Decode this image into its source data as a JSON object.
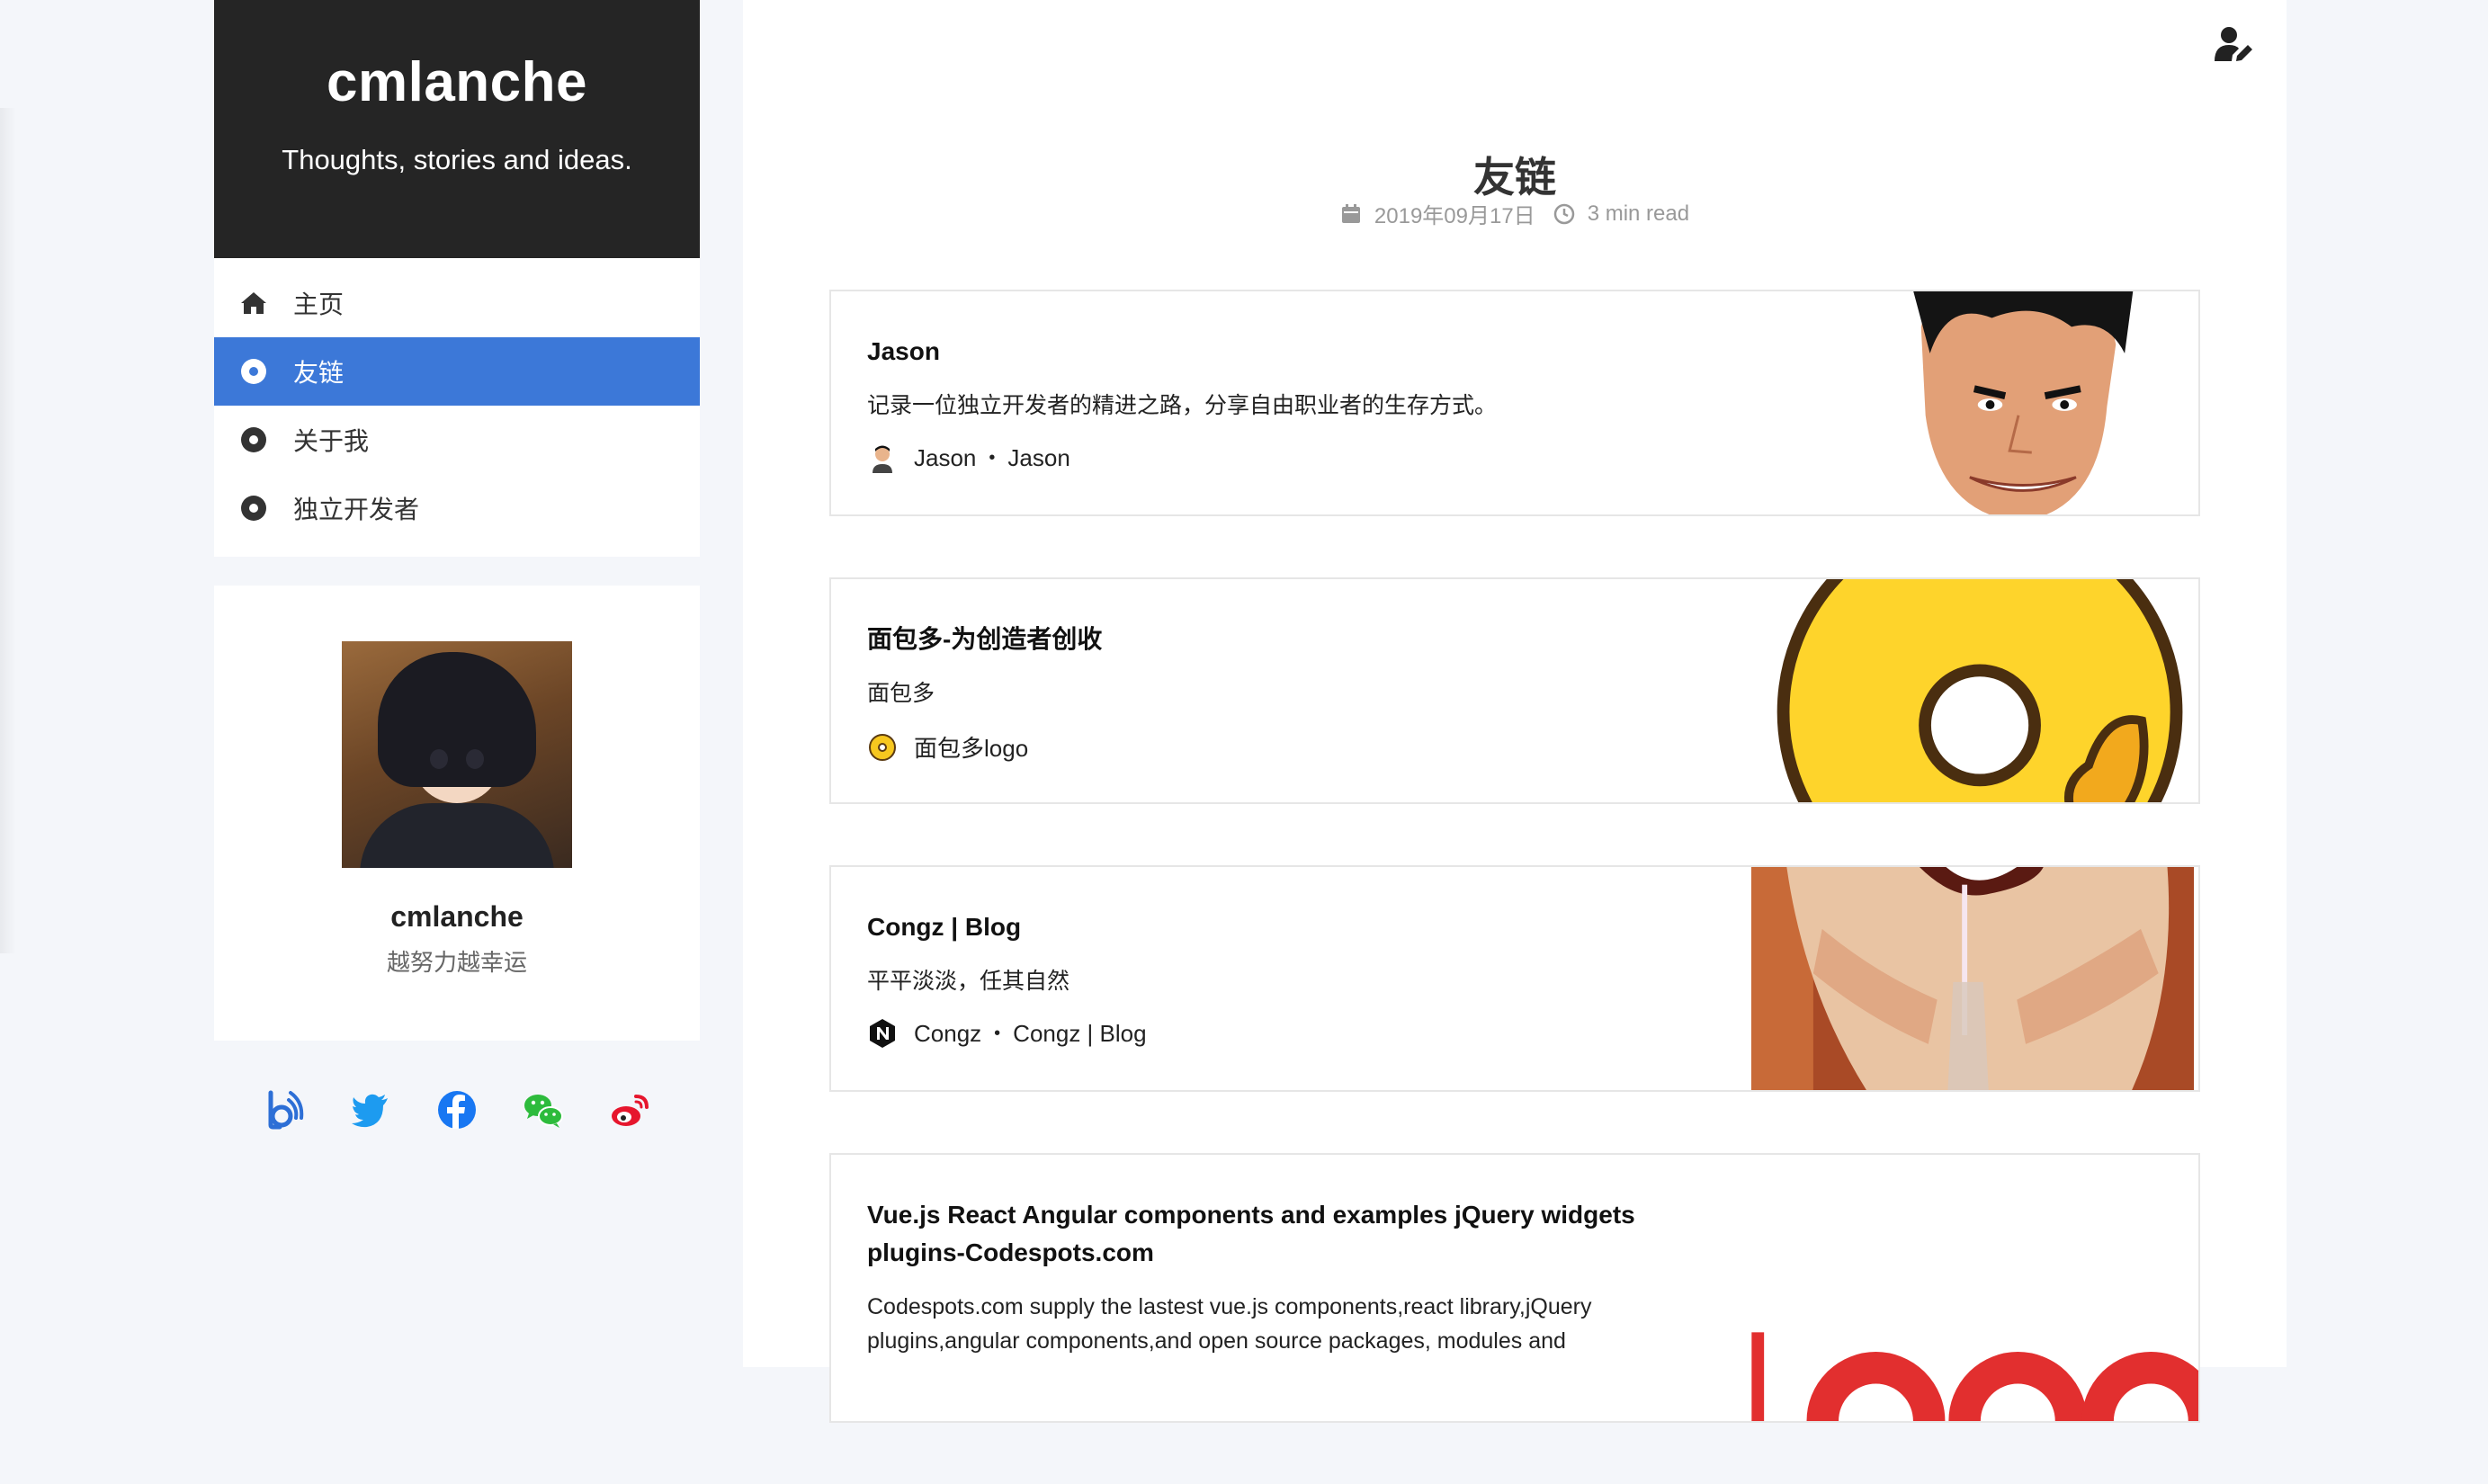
{
  "site": {
    "title": "cmlanche",
    "subtitle": "Thoughts, stories and ideas."
  },
  "nav": {
    "items": [
      {
        "label": "主页",
        "icon": "home-icon"
      },
      {
        "label": "友链",
        "icon": "dot-circle-icon",
        "active": true
      },
      {
        "label": "关于我",
        "icon": "dot-circle-icon"
      },
      {
        "label": "独立开发者",
        "icon": "dot-circle-icon"
      }
    ]
  },
  "profile": {
    "name": "cmlanche",
    "motto": "越努力越幸运"
  },
  "social": [
    "bilibili-icon",
    "twitter-icon",
    "facebook-icon",
    "wechat-icon",
    "weibo-icon"
  ],
  "page": {
    "title": "友链",
    "date": "2019年09月17日",
    "read_time": "3 min read"
  },
  "cards": [
    {
      "title": "Jason",
      "desc": "记录一位独立开发者的精进之路，分享自由职业者的生存方式。",
      "author": "Jason",
      "site": "Jason"
    },
    {
      "title": "面包多-为创造者创收",
      "desc": "面包多",
      "author": "面包多logo"
    },
    {
      "title": "Congz | Blog",
      "desc": "平平淡淡，任其自然",
      "author": "Congz",
      "site": "Congz | Blog"
    },
    {
      "title": "Vue.js React Angular components and examples jQuery widgets plugins-Codespots.com",
      "desc": "Codespots.com supply the lastest vue.js components,react library,jQuery plugins,angular components,and open source packages, modules and"
    }
  ],
  "colors": {
    "brand_bg": "#252525",
    "active_nav": "#3c78d8"
  }
}
